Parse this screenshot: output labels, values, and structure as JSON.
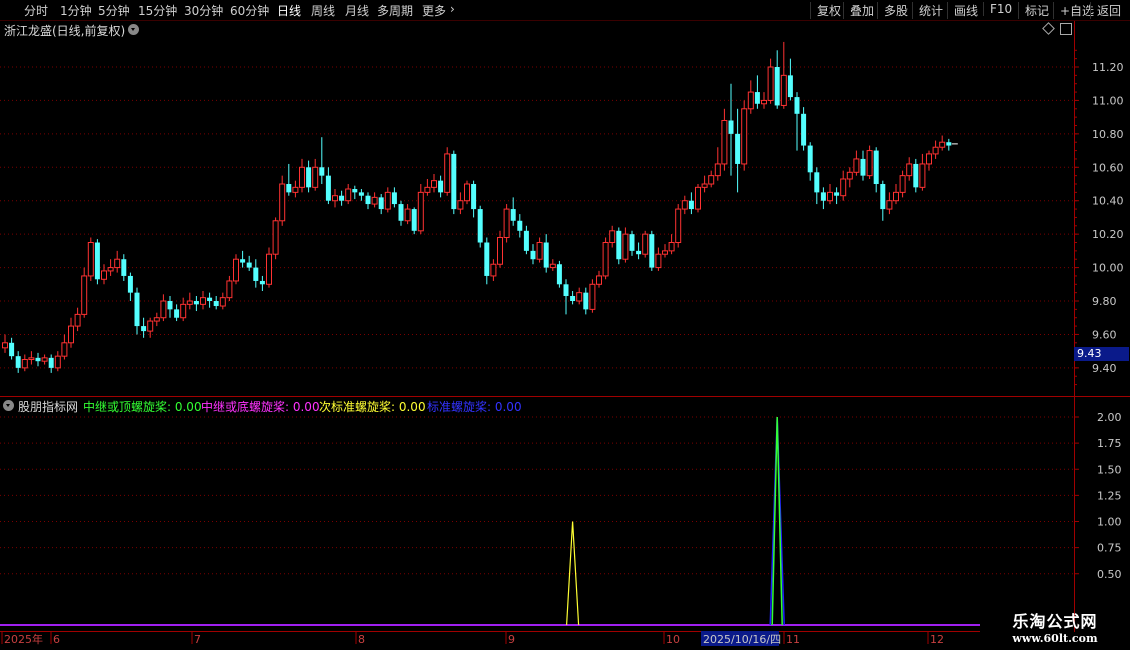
{
  "toolbar": {
    "periods": [
      "分时",
      "1分钟",
      "5分钟",
      "15分钟",
      "30分钟",
      "60分钟",
      "日线",
      "周线",
      "月线",
      "多周期",
      "更多"
    ],
    "active_period": "日线",
    "right_buttons": [
      "复权",
      "叠加",
      "多股",
      "统计",
      "画线",
      "F10",
      "标记",
      "+自选",
      "返回"
    ]
  },
  "stock": {
    "title": "浙江龙盛(日线,前复权)",
    "last_price_tag": "9.43"
  },
  "indicator": {
    "name": "股朋指标网",
    "items": [
      {
        "label": "中继或顶螺旋桨:",
        "value": "0.00",
        "color": "#33ff33"
      },
      {
        "label": "中继或底螺旋桨:",
        "value": "0.00",
        "color": "#ff33ff"
      },
      {
        "label": "次标准螺旋桨:",
        "value": "0.00",
        "color": "#ffff33"
      },
      {
        "label": "标准螺旋桨:",
        "value": "0.00",
        "color": "#3333ff"
      }
    ]
  },
  "price_axis": {
    "ticks": [
      "11.20",
      "11.00",
      "10.80",
      "10.60",
      "10.40",
      "10.20",
      "10.00",
      "9.80",
      "9.60",
      "9.40"
    ],
    "tick_values": [
      11.2,
      11.0,
      10.8,
      10.6,
      10.4,
      10.2,
      10.0,
      9.8,
      9.6,
      9.4
    ]
  },
  "indicator_axis": {
    "ticks": [
      "2.00",
      "1.75",
      "1.50",
      "1.25",
      "1.00",
      "0.75",
      "0.50"
    ],
    "tick_values": [
      2.0,
      1.75,
      1.5,
      1.25,
      1.0,
      0.75,
      0.5
    ]
  },
  "x_axis": {
    "labels": [
      "2025年",
      "6",
      "7",
      "8",
      "9",
      "10",
      "2025/10/16/四",
      "11",
      "12"
    ],
    "cursor_label": "2025/10/16/四"
  },
  "watermark": {
    "text": "乐淘公式网",
    "url": "www.60lt.com"
  },
  "colors": {
    "up": "#ff3232",
    "down": "#54ffff",
    "grid": "#7a0000",
    "axis": "#a00000",
    "price_tag_bg": "#0a1a8a"
  },
  "chart_data": {
    "type": "candlestick",
    "candles": [
      [
        9.52,
        9.55,
        9.6,
        9.49
      ],
      [
        9.55,
        9.47,
        9.58,
        9.45
      ],
      [
        9.47,
        9.4,
        9.5,
        9.37
      ],
      [
        9.4,
        9.45,
        9.48,
        9.38
      ],
      [
        9.45,
        9.46,
        9.5,
        9.42
      ],
      [
        9.46,
        9.44,
        9.49,
        9.41
      ],
      [
        9.44,
        9.46,
        9.48,
        9.42
      ],
      [
        9.46,
        9.4,
        9.48,
        9.37
      ],
      [
        9.4,
        9.47,
        9.5,
        9.38
      ],
      [
        9.47,
        9.55,
        9.6,
        9.45
      ],
      [
        9.55,
        9.65,
        9.7,
        9.52
      ],
      [
        9.65,
        9.72,
        9.76,
        9.62
      ],
      [
        9.72,
        9.95,
        10.0,
        9.7
      ],
      [
        9.95,
        10.15,
        10.18,
        9.92
      ],
      [
        10.15,
        9.93,
        10.17,
        9.9
      ],
      [
        9.93,
        9.98,
        10.02,
        9.9
      ],
      [
        9.98,
        10.0,
        10.05,
        9.95
      ],
      [
        10.0,
        10.05,
        10.1,
        9.97
      ],
      [
        10.05,
        9.95,
        10.08,
        9.92
      ],
      [
        9.95,
        9.85,
        9.97,
        9.8
      ],
      [
        9.85,
        9.65,
        9.88,
        9.6
      ],
      [
        9.65,
        9.62,
        9.7,
        9.58
      ],
      [
        9.62,
        9.68,
        9.7,
        9.58
      ],
      [
        9.68,
        9.7,
        9.73,
        9.65
      ],
      [
        9.7,
        9.8,
        9.84,
        9.68
      ],
      [
        9.8,
        9.75,
        9.83,
        9.7
      ],
      [
        9.75,
        9.7,
        9.78,
        9.68
      ],
      [
        9.7,
        9.78,
        9.82,
        9.68
      ],
      [
        9.78,
        9.8,
        9.85,
        9.75
      ],
      [
        9.8,
        9.78,
        9.83,
        9.74
      ],
      [
        9.78,
        9.82,
        9.86,
        9.75
      ],
      [
        9.82,
        9.8,
        9.85,
        9.76
      ],
      [
        9.8,
        9.77,
        9.83,
        9.75
      ],
      [
        9.77,
        9.82,
        9.85,
        9.75
      ],
      [
        9.82,
        9.92,
        9.95,
        9.8
      ],
      [
        9.92,
        10.05,
        10.08,
        9.9
      ],
      [
        10.05,
        10.03,
        10.1,
        10.0
      ],
      [
        10.03,
        10.0,
        10.07,
        9.98
      ],
      [
        10.0,
        9.92,
        10.05,
        9.88
      ],
      [
        9.92,
        9.9,
        9.95,
        9.86
      ],
      [
        9.9,
        10.08,
        10.12,
        9.88
      ],
      [
        10.08,
        10.28,
        10.3,
        10.05
      ],
      [
        10.28,
        10.5,
        10.55,
        10.25
      ],
      [
        10.5,
        10.45,
        10.62,
        10.43
      ],
      [
        10.45,
        10.48,
        10.52,
        10.42
      ],
      [
        10.48,
        10.6,
        10.65,
        10.45
      ],
      [
        10.6,
        10.48,
        10.64,
        10.45
      ],
      [
        10.48,
        10.6,
        10.65,
        10.46
      ],
      [
        10.6,
        10.55,
        10.78,
        10.5
      ],
      [
        10.55,
        10.4,
        10.6,
        10.38
      ],
      [
        10.4,
        10.43,
        10.47,
        10.36
      ],
      [
        10.43,
        10.4,
        10.46,
        10.37
      ],
      [
        10.4,
        10.47,
        10.5,
        10.38
      ],
      [
        10.47,
        10.45,
        10.49,
        10.41
      ],
      [
        10.45,
        10.43,
        10.47,
        10.4
      ],
      [
        10.43,
        10.38,
        10.45,
        10.35
      ],
      [
        10.38,
        10.42,
        10.45,
        10.36
      ],
      [
        10.42,
        10.35,
        10.44,
        10.32
      ],
      [
        10.35,
        10.45,
        10.48,
        10.33
      ],
      [
        10.45,
        10.38,
        10.48,
        10.36
      ],
      [
        10.38,
        10.28,
        10.4,
        10.25
      ],
      [
        10.28,
        10.35,
        10.38,
        10.26
      ],
      [
        10.35,
        10.22,
        10.36,
        10.2
      ],
      [
        10.22,
        10.45,
        10.5,
        10.2
      ],
      [
        10.45,
        10.48,
        10.53,
        10.43
      ],
      [
        10.48,
        10.52,
        10.56,
        10.45
      ],
      [
        10.52,
        10.45,
        10.55,
        10.42
      ],
      [
        10.45,
        10.68,
        10.72,
        10.43
      ],
      [
        10.68,
        10.35,
        10.7,
        10.32
      ],
      [
        10.35,
        10.4,
        10.45,
        10.32
      ],
      [
        10.4,
        10.5,
        10.52,
        10.38
      ],
      [
        10.5,
        10.35,
        10.52,
        10.3
      ],
      [
        10.35,
        10.15,
        10.37,
        10.12
      ],
      [
        10.15,
        9.95,
        10.18,
        9.9
      ],
      [
        9.95,
        10.02,
        10.05,
        9.92
      ],
      [
        10.02,
        10.18,
        10.22,
        10.0
      ],
      [
        10.18,
        10.35,
        10.38,
        10.15
      ],
      [
        10.35,
        10.28,
        10.42,
        10.25
      ],
      [
        10.28,
        10.22,
        10.32,
        10.18
      ],
      [
        10.22,
        10.1,
        10.25,
        10.08
      ],
      [
        10.1,
        10.05,
        10.14,
        10.02
      ],
      [
        10.05,
        10.15,
        10.18,
        10.03
      ],
      [
        10.15,
        10.0,
        10.2,
        9.97
      ],
      [
        10.0,
        10.02,
        10.05,
        9.98
      ],
      [
        10.02,
        9.9,
        10.04,
        9.88
      ],
      [
        9.9,
        9.83,
        9.93,
        9.72
      ],
      [
        9.83,
        9.8,
        9.86,
        9.78
      ],
      [
        9.8,
        9.85,
        9.88,
        9.78
      ],
      [
        9.85,
        9.75,
        9.88,
        9.72
      ],
      [
        9.75,
        9.9,
        9.93,
        9.73
      ],
      [
        9.9,
        9.95,
        9.98,
        9.88
      ],
      [
        9.95,
        10.15,
        10.18,
        9.93
      ],
      [
        10.15,
        10.22,
        10.25,
        10.12
      ],
      [
        10.22,
        10.05,
        10.24,
        10.02
      ],
      [
        10.05,
        10.2,
        10.24,
        10.03
      ],
      [
        10.2,
        10.1,
        10.22,
        10.07
      ],
      [
        10.1,
        10.08,
        10.15,
        10.05
      ],
      [
        10.08,
        10.2,
        10.22,
        10.06
      ],
      [
        10.2,
        10.0,
        10.22,
        9.98
      ],
      [
        10.0,
        10.08,
        10.12,
        9.98
      ],
      [
        10.08,
        10.1,
        10.14,
        10.06
      ],
      [
        10.1,
        10.15,
        10.2,
        10.08
      ],
      [
        10.15,
        10.35,
        10.38,
        10.12
      ],
      [
        10.35,
        10.4,
        10.43,
        10.32
      ],
      [
        10.4,
        10.35,
        10.45,
        10.32
      ],
      [
        10.35,
        10.48,
        10.5,
        10.33
      ],
      [
        10.48,
        10.5,
        10.55,
        10.45
      ],
      [
        10.5,
        10.55,
        10.58,
        10.48
      ],
      [
        10.55,
        10.62,
        10.72,
        10.52
      ],
      [
        10.62,
        10.88,
        10.95,
        10.58
      ],
      [
        10.88,
        10.8,
        11.1,
        10.55
      ],
      [
        10.8,
        10.62,
        10.95,
        10.45
      ],
      [
        10.62,
        10.95,
        11.0,
        10.58
      ],
      [
        10.95,
        11.05,
        11.12,
        10.92
      ],
      [
        11.05,
        10.98,
        11.15,
        10.95
      ],
      [
        10.98,
        11.0,
        11.05,
        10.95
      ],
      [
        11.0,
        11.2,
        11.25,
        10.98
      ],
      [
        11.2,
        10.97,
        11.3,
        10.95
      ],
      [
        10.97,
        11.15,
        11.35,
        10.95
      ],
      [
        11.15,
        11.02,
        11.25,
        11.0
      ],
      [
        11.02,
        10.92,
        11.05,
        10.7
      ],
      [
        10.92,
        10.73,
        10.96,
        10.7
      ],
      [
        10.73,
        10.57,
        10.75,
        10.52
      ],
      [
        10.57,
        10.45,
        10.6,
        10.38
      ],
      [
        10.45,
        10.4,
        10.48,
        10.35
      ],
      [
        10.4,
        10.45,
        10.5,
        10.38
      ],
      [
        10.45,
        10.43,
        10.48,
        10.38
      ],
      [
        10.43,
        10.53,
        10.58,
        10.4
      ],
      [
        10.53,
        10.57,
        10.6,
        10.48
      ],
      [
        10.57,
        10.65,
        10.7,
        10.55
      ],
      [
        10.65,
        10.55,
        10.7,
        10.52
      ],
      [
        10.55,
        10.7,
        10.73,
        10.53
      ],
      [
        10.7,
        10.5,
        10.72,
        10.45
      ],
      [
        10.5,
        10.35,
        10.52,
        10.28
      ],
      [
        10.35,
        10.4,
        10.45,
        10.32
      ],
      [
        10.4,
        10.45,
        10.5,
        10.38
      ],
      [
        10.45,
        10.55,
        10.58,
        10.42
      ],
      [
        10.55,
        10.62,
        10.66,
        10.52
      ],
      [
        10.62,
        10.48,
        10.65,
        10.45
      ],
      [
        10.48,
        10.62,
        10.68,
        10.46
      ],
      [
        10.62,
        10.68,
        10.7,
        10.58
      ],
      [
        10.68,
        10.72,
        10.76,
        10.65
      ],
      [
        10.72,
        10.75,
        10.79,
        10.7
      ],
      [
        10.75,
        10.73,
        10.77,
        10.7
      ]
    ],
    "indicator_signals": [
      {
        "index": 86,
        "value": 1.0,
        "series": "次标准螺旋桨"
      },
      {
        "index": 117,
        "value": 2.0,
        "series": "中继或顶螺旋桨"
      }
    ]
  }
}
